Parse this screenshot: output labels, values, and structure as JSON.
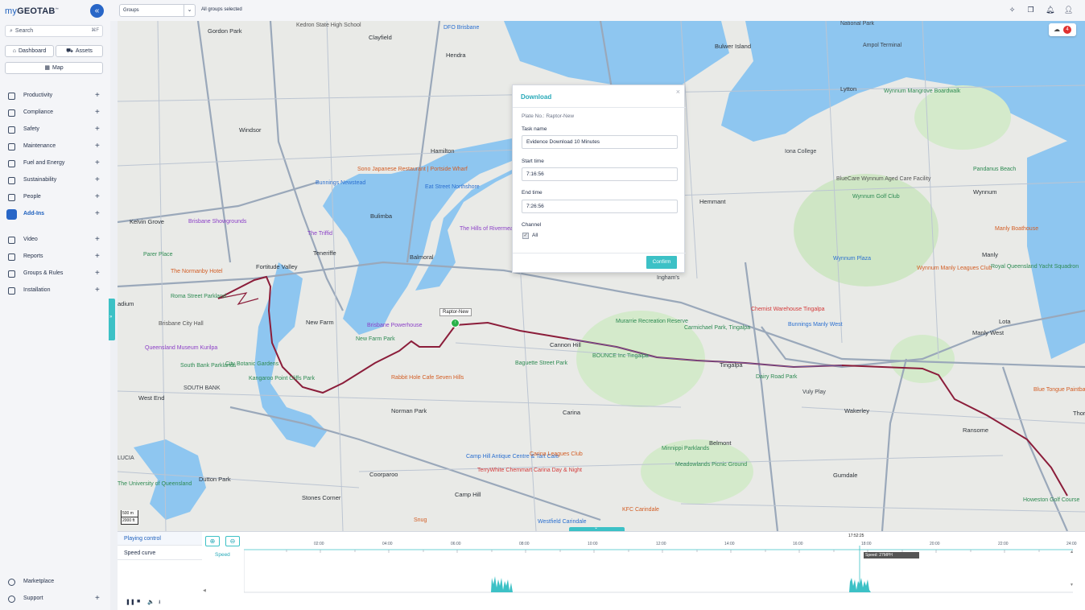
{
  "brand": {
    "logo_my": "my",
    "logo_rest": "GEOTAB",
    "trademark": "™"
  },
  "sidebar": {
    "collapse_icon": "«",
    "search_placeholder": "Search",
    "search_shortcut": "⌘F",
    "quick": [
      {
        "label": "Dashboard",
        "icon": "home-icon"
      },
      {
        "label": "Assets",
        "icon": "truck-icon"
      },
      {
        "label": "Map",
        "icon": "map-icon"
      }
    ],
    "items": [
      {
        "label": "Productivity",
        "icon": "productivity-icon"
      },
      {
        "label": "Compliance",
        "icon": "compliance-icon"
      },
      {
        "label": "Safety",
        "icon": "safety-icon"
      },
      {
        "label": "Maintenance",
        "icon": "wrench-icon"
      },
      {
        "label": "Fuel and Energy",
        "icon": "fuel-icon"
      },
      {
        "label": "Sustainability",
        "icon": "leaf-icon"
      },
      {
        "label": "People",
        "icon": "people-icon"
      },
      {
        "label": "Add-Ins",
        "icon": "puzzle-icon",
        "active": true
      },
      {
        "label": "Video",
        "icon": "video-icon"
      },
      {
        "label": "Reports",
        "icon": "reports-icon"
      },
      {
        "label": "Groups & Rules",
        "icon": "groups-icon"
      },
      {
        "label": "Installation",
        "icon": "installation-icon"
      }
    ],
    "footer": [
      {
        "label": "Marketplace",
        "icon": "marketplace-icon"
      },
      {
        "label": "Support",
        "icon": "support-icon"
      }
    ],
    "plus_glyph": "+"
  },
  "topbar": {
    "groups_label": "Groups",
    "groups_caption": "All groups selected",
    "chevron": "⌄",
    "icons": [
      "sparkle-icon",
      "windows-icon",
      "bell-icon",
      "user-icon"
    ]
  },
  "map": {
    "download_badge_count": "4",
    "vehicle_name": "Raptor-New",
    "vehicle_glyph": "↑",
    "scale_1": "500 m",
    "scale_2": "2000 ft",
    "side_tab_glyph": "»",
    "toggle_glyph": "⌄",
    "labels": {
      "gordon_park": "Gordon Park",
      "clayfield": "Clayfield",
      "hendra": "Hendra",
      "dfo": "DFO Brisbane",
      "kedron": "Kedron State High School",
      "bulwer": "Bulwer Island",
      "national_park": "National Park",
      "ampol": "Ampol Terminal",
      "windsor": "Windsor",
      "lytton": "Lytton",
      "wynnum_mangrove": "Wynnum Mangrove Boardwalk",
      "hamilton": "Hamilton",
      "sono": "Sono Japanese Restaurant | Portside Wharf",
      "bunnings_newstead": "Bunnings Newstead",
      "eat_street": "Eat Street Northshore",
      "iona": "Iona College",
      "wynnum_golf": "Wynnum Golf Club",
      "bluecare": "BlueCare Wynnum Aged Care Facility",
      "pandanus": "Pandanus Beach",
      "wynnum": "Wynnum",
      "kelvin_grove": "Kelvin Grove",
      "brisbane_showgrounds": "Brisbane Showgrounds",
      "bulimba": "Bulimba",
      "hemmant": "Hemmant",
      "the_triffid": "The Triffid",
      "hills_rivermead": "The Hills of Rivermead",
      "manly_boathouse": "Manly Boathouse",
      "parer_place": "Parer Place",
      "teneriffe": "Teneriffe",
      "balmoral": "Balmoral",
      "manly": "Manly",
      "fortitude_valley": "Fortitude Valley",
      "normanby": "The Normanby Hotel",
      "inghams": "Ingham's",
      "wynnum_plaza": "Wynnum Plaza",
      "wynnum_manly_leagues": "Wynnum Manly Leagues Club",
      "royal_qld_yacht": "Royal Queensland Yacht Squadron",
      "roma_street": "Roma Street Parkland",
      "chemist_warehouse": "Chemist Warehouse Tingalpa",
      "lota": "Lota",
      "new_farm": "New Farm",
      "brisbane_powerhouse": "Brisbane Powerhouse",
      "murarrie": "Murarrie Recreation Reserve",
      "carmichael": "Carmichael Park, Tingalpa",
      "bunnings_manly_west": "Bunnings Manly West",
      "manly_west": "Manly West",
      "brisbane_city_hall": "Brisbane City Hall",
      "new_farm_park": "New Farm Park",
      "cannon_hill": "Cannon Hill",
      "bounce": "BOUNCE Inc Tingalpa",
      "tingalpa": "Tingalpa",
      "qld_museum": "Queensland Museum Kurilpa",
      "south_bank": "South Bank Parklands",
      "city_botanic": "City Botanic Gardens",
      "kangaroo_point": "Kangaroo Point Cliffs Park",
      "baguette": "Baguette Street Park",
      "rabbit_hole": "Rabbit Hole Cafe Seven Hills",
      "dairy_road": "Dairy Road Park",
      "vuly": "Vuly Play",
      "blue_tongue": "Blue Tongue Paintball",
      "south_bank_sub": "SOUTH BANK",
      "west_end": "West End",
      "norman_park": "Norman Park",
      "carina": "Carina",
      "wakerley": "Wakerley",
      "thorneside": "Thorn",
      "belmont": "Belmont",
      "ransome": "Ransome",
      "lucia": "LUCIA",
      "uq": "The University of Queensland",
      "dutton_park": "Dutton Park",
      "camp_hill_antique": "Camp Hill Antique Centre & Tart Cafe",
      "carina_leagues": "Carina Leagues Club",
      "minnippi": "Minnippi Parklands",
      "meadowlands": "Meadowlands Picnic Ground",
      "coorparoo": "Coorparoo",
      "terrywhite": "TerryWhite Chemmart Carina Day & Night",
      "gumdale": "Gumdale",
      "stones_corner": "Stones Corner",
      "camp_hill": "Camp Hill",
      "snug": "Snug",
      "westfield_carindale": "Westfield Carindale",
      "kfc_carindale": "KFC Carindale",
      "howeston": "Howeston Golf Course",
      "radium": "adium"
    }
  },
  "dialog": {
    "title": "Download",
    "close_glyph": "×",
    "plate": "Plate No.: Raptor-New",
    "task_label": "Task name",
    "task_value": "Evidence Download 10 Minutes",
    "start_label": "Start time",
    "start_value": "7:16:56",
    "end_label": "End time",
    "end_value": "7:26:56",
    "channel_label": "Channel",
    "channel_all": "All",
    "check_glyph": "✓",
    "confirm": "Confirm"
  },
  "bottom": {
    "tabs": [
      "Playing control",
      "Speed curve"
    ],
    "zoom_in_glyph": "⊕",
    "zoom_out_glyph": "⊖",
    "ticks": [
      "02:00",
      "04:00",
      "06:00",
      "08:00",
      "10:00",
      "12:00",
      "14:00",
      "16:00",
      "18:00",
      "20:00",
      "22:00",
      "24:00"
    ],
    "cursor_time": "17:52:25",
    "speed_label": "Speed",
    "speed_tip": "Speed: 27MPH",
    "controls": [
      "pause-icon",
      "stop-icon",
      "volume-icon",
      "download-icon"
    ],
    "control_glyphs": [
      "❚❚",
      "■",
      "🔈",
      "⭳"
    ]
  }
}
